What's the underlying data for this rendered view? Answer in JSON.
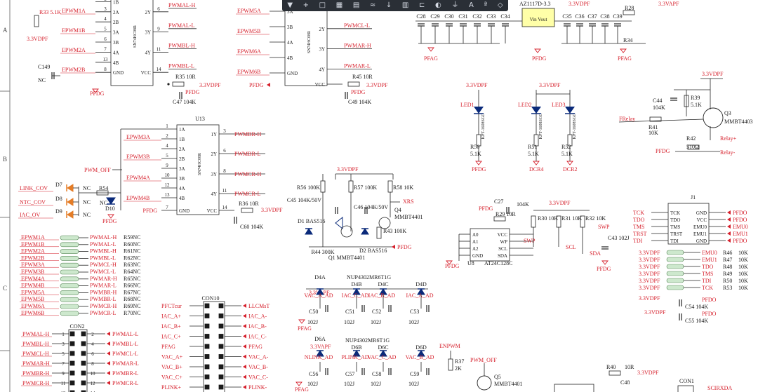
{
  "toolbar": {
    "tools": [
      {
        "name": "filter-icon",
        "glyph": "▼"
      },
      {
        "name": "crosshair-icon",
        "glyph": "+"
      },
      {
        "name": "rectangle-icon",
        "glyph": "□"
      },
      {
        "name": "grid-icon",
        "glyph": "▦"
      },
      {
        "name": "note-icon",
        "glyph": "▤"
      },
      {
        "name": "bus-icon",
        "glyph": "≈"
      },
      {
        "name": "down-arrow-icon",
        "glyph": "↓"
      },
      {
        "name": "component-icon",
        "glyph": "▥"
      },
      {
        "name": "port-icon",
        "glyph": "⊏"
      },
      {
        "name": "probe-icon",
        "glyph": "◐"
      },
      {
        "name": "power-icon",
        "glyph": "⏚"
      },
      {
        "name": "text-icon",
        "glyph": "A"
      },
      {
        "name": "pin-icon",
        "glyph": "ª"
      },
      {
        "name": "shape-icon",
        "glyph": "◇"
      }
    ]
  },
  "border": {
    "rows": [
      "A",
      "B",
      "C"
    ]
  },
  "power": {
    "v33": "3.3VDPF",
    "v33a": "3.3VAPF",
    "pfdg": "PFDG",
    "pfag": "PFAG",
    "dcr": "DCR4",
    "dcr2": "DCR2",
    "nc": "NC"
  },
  "u12": {
    "chip": "SN74HC08R",
    "pins_left": [
      "1A",
      "1B",
      "2A",
      "2B",
      "3A",
      "3B",
      "4A",
      "4B",
      "GND"
    ],
    "pins_right": [
      "1Y",
      "2Y",
      "3Y",
      "4Y",
      "VCC"
    ],
    "nums_left": [
      "1",
      "2",
      "3",
      "4",
      "5",
      "6",
      "7",
      "13",
      "8"
    ],
    "nums_right": [
      "3",
      "6",
      "9",
      "11",
      "14"
    ],
    "in_labels": [
      "EPWM1A",
      "EPWM1B",
      "EPWM2A",
      "EPWM2B"
    ],
    "out_labels": [
      "PWMAL-H",
      "PWMAL-L",
      "PWMBL-H",
      "PWMBL-L"
    ],
    "r_ref": "R35 10R",
    "cap": "C47 104K",
    "res": "R33 5.1K",
    "c149": "C149"
  },
  "u13": {
    "ref": "U13",
    "chip": "SN74HC08R",
    "pins_left": [
      "1A",
      "1B",
      "2A",
      "2B",
      "3A",
      "3B",
      "4A",
      "4B",
      "GND"
    ],
    "pins_right": [
      "1Y",
      "2Y",
      "3Y",
      "4Y",
      "VCC"
    ],
    "nums_left": [
      "1",
      "2",
      "4",
      "5",
      "9",
      "10",
      "12",
      "13",
      "7"
    ],
    "nums_right": [
      "3",
      "6",
      "8",
      "11",
      "14"
    ],
    "in_labels": [
      "EPWM3A",
      "EPWM3B",
      "EPWM4A",
      "EPWM4B"
    ],
    "out_labels": [
      "PWMBR-H",
      "PWMBR-L",
      "PWMCR-H",
      "PWMCR-L"
    ],
    "r_ref": "R36 10R",
    "cap": "C60 104K",
    "pwm_off": "PWM_OFF"
  },
  "u14": {
    "chip": "SN74HC08R",
    "in_labels": [
      "EPWM5A",
      "EPWM5B",
      "EPWM6A",
      "EPWM6B"
    ],
    "out_labels": [
      "PWMCL-H",
      "PWMCL-L",
      "PWMAR-H",
      "PWMAR-L"
    ],
    "r_ref": "R45 10R",
    "cap": "C49 104K",
    "pins_right": [
      "1Y",
      "2Y",
      "3Y",
      "4Y",
      "VCC"
    ],
    "pins_left": [
      "3A",
      "3B",
      "4A",
      "4B",
      "GND"
    ]
  },
  "diodes": {
    "labels": [
      "LINK_COV",
      "NTC_COV",
      "IAC_OV"
    ],
    "refs": [
      "D7",
      "D8",
      "D9"
    ],
    "nc": "NC",
    "r54": "R54",
    "d10": "D10"
  },
  "resarray": {
    "left": [
      "EPWM1A",
      "EPWM1B",
      "EPWM2A",
      "EPWM2B",
      "EPWM3A",
      "EPWM3B",
      "EPWM4A",
      "EPWM4B",
      "EPWM5A",
      "EPWM5B",
      "EPWM6A",
      "EPWM6B"
    ],
    "right": [
      "PWMAL-H",
      "PWMAL-L",
      "PWMBL-H",
      "PWMBL-L",
      "PWMCL-H",
      "PWMCL-L",
      "PWMAR-H",
      "PWMAR-L",
      "PWMBR-H",
      "PWMBR-L",
      "PWMCR-H",
      "PWMCR-L"
    ],
    "refs": [
      "R59NC",
      "R60NC",
      "R61NC",
      "R62NC",
      "R63NC",
      "R64NC",
      "R65NC",
      "R66NC",
      "R67NC",
      "R68NC",
      "R69NC",
      "R70NC"
    ]
  },
  "con2": {
    "ref": "CON2",
    "left": [
      "PWMAL-H",
      "PWMBL-H",
      "PWMCL-H",
      "PWMAR-H",
      "PWMBR-H",
      "PWMCR-H"
    ],
    "right": [
      "PWMAL-L",
      "PWMBL-L",
      "PWMCL-L",
      "PWMAR-L",
      "PWMBR-L",
      "PWMCR-L"
    ],
    "lnums": [
      "1",
      "3",
      "5",
      "7",
      "9",
      "11",
      "13"
    ],
    "rnums": [
      "2",
      "4",
      "6",
      "8",
      "10",
      "12",
      "14"
    ]
  },
  "con10": {
    "ref": "CON10",
    "left": [
      "PFCTcur",
      "IAC_A+",
      "IAC_B+",
      "IAC_C+",
      "PFAG",
      "VAC_A+",
      "VAC_B+",
      "VAC_C+",
      "PLINK+"
    ],
    "right": [
      "LLCMsT",
      "IAC_A-",
      "IAC_B-",
      "IAC_C-",
      "PFAG",
      "VAC_A-",
      "VAC_B-",
      "VAC_C-",
      "PLINK-"
    ]
  },
  "q1circ": {
    "rail": "3.3VDPF",
    "r56": "R56 100K",
    "r57": "R57 100K",
    "r58": "R58 10K",
    "c45": "C45 104K/50V",
    "c46": "C46 104K/50V",
    "q4": "Q4",
    "q4p": "MMBT4401",
    "r43": "R43 100K",
    "d1": "D1 BAS516",
    "r44": "R44 300K",
    "q1": "Q1 MMBT4401",
    "d2": "D2 BAS516",
    "xrs": "XRS",
    "pfdg": "PFDG"
  },
  "tvs": {
    "title1": "NUP4302MR6T1G",
    "refs1": [
      "D4A",
      "D4B",
      "D4C",
      "D4D"
    ],
    "nets1": [
      "VAC_A_AD",
      "IAC_C_AD",
      "IAC_B_AD",
      "IAC_A_AD"
    ],
    "caps1": [
      "C50",
      "C51",
      "C52",
      "C53"
    ],
    "cv": "102J",
    "title2": "NUP4302MR6T1G",
    "refs2": [
      "D6A",
      "D6B",
      "D6C",
      "D6D"
    ],
    "nets2": [
      "NLINK_AD",
      "PLINK_AD",
      "VAC_C_AD",
      "VAC_B_AD"
    ],
    "caps2": [
      "C56",
      "C57",
      "C58",
      "C59"
    ],
    "v33a": "3.3VAPF"
  },
  "eeprom": {
    "ref": "U8",
    "chip": "AT24C128C",
    "pins_left": [
      "A0",
      "A1",
      "A2",
      "GND"
    ],
    "pins_right": [
      "VCC",
      "WP",
      "SCL",
      "SDA"
    ],
    "c27": "C27",
    "c27v": "104K",
    "r29": "R29 10R",
    "r30": "R30 10K",
    "r31": "R31 10K",
    "r32": "R32 10K",
    "swp": "SWP",
    "c43": "C43 102J",
    "wp_net": "SWP",
    "scl": "SCL",
    "sda": "SDA",
    "pfdo": "PFDG"
  },
  "leds": {
    "items": [
      {
        "ref": "LED1",
        "part": "KPT-1608SGC",
        "r": "R50",
        "rv": "5.1K",
        "gnd": "PFDG"
      },
      {
        "ref": "LED2",
        "part": "KPT-1608SGC",
        "r": "R51",
        "rv": "5.1K",
        "gnd": "DCR4"
      },
      {
        "ref": "LED3",
        "part": "KPT-1608SGC",
        "r": "R52",
        "rv": "5.1K",
        "gnd": "DCR2"
      }
    ]
  },
  "relay": {
    "rail": "3.3VDPF",
    "c44": "C44",
    "c44v": "104K",
    "r39": "R39",
    "r39v": "5.1K",
    "q3": "Q3",
    "q3p": "MMBT4403",
    "r41": "R41",
    "r41v": "10K",
    "frelay": "FRelay",
    "r42": "R42",
    "r42v": "510Ω",
    "relp": "Relay+",
    "relm": "Relay-",
    "pfdg": "PFDG"
  },
  "reg": {
    "part": "AZ1117D-3.3",
    "pins": "Vin Vout",
    "caps": [
      "C28",
      "C29",
      "C30",
      "C31",
      "C32",
      "C33",
      "C34",
      "C35",
      "C36",
      "C37",
      "C38",
      "C39"
    ],
    "r": "R28",
    "r34": "R34"
  },
  "jtag": {
    "ref": "J1",
    "left": [
      "TCK",
      "TDO",
      "TMS",
      "TRST",
      "TDI"
    ],
    "ileft": [
      "TCK",
      "TDO",
      "TMS",
      "TRST",
      "TDI"
    ],
    "iright": [
      "GND",
      "VCC",
      "EMU0",
      "EMU1",
      "GND"
    ],
    "right": [
      "PFDO",
      "PFDO",
      "EMU0",
      "EMU1",
      "PFDO"
    ],
    "pulls": [
      {
        "in": "3.3VDPF",
        "net": "EMU0",
        "r": "R46",
        "v": "10K"
      },
      {
        "in": "3.3VDPF",
        "net": "EMU1",
        "r": "R47",
        "v": "10K"
      },
      {
        "in": "3.3VDPF",
        "net": "TDO",
        "r": "R48",
        "v": "10K"
      },
      {
        "in": "3.3VDPF",
        "net": "TMS",
        "r": "R49",
        "v": "10K"
      },
      {
        "in": "3.3VDPF",
        "net": "TDI",
        "r": "R50",
        "v": "10K"
      },
      {
        "in": "3.3VDPF",
        "net": "TCK",
        "r": "R53",
        "v": "10K"
      }
    ],
    "c54": "C54 104K",
    "c55": "C55 104K",
    "pfdo": "PFDO"
  },
  "bottom": {
    "epwm": "ENPWM",
    "r37": "R37",
    "r37v": "2K",
    "q5": "Q5",
    "q5p": "MMBT4401",
    "pwmoff": "PWM_OFF",
    "r40": "R40",
    "r40v": "10R",
    "c48": "C48",
    "con1": "CON1",
    "sci": "SCIRXDA"
  }
}
